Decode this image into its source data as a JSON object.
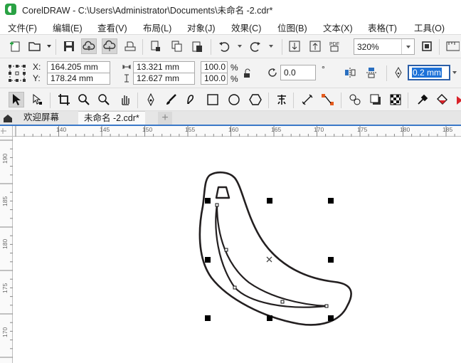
{
  "window": {
    "title": "CorelDRAW - C:\\Users\\Administrator\\Documents\\未命名 -2.cdr*"
  },
  "menu": {
    "items": [
      "文件(F)",
      "编辑(E)",
      "查看(V)",
      "布局(L)",
      "对象(J)",
      "效果(C)",
      "位图(B)",
      "文本(X)",
      "表格(T)",
      "工具(O)"
    ]
  },
  "toolbar": {
    "zoom_value": "320%"
  },
  "properties": {
    "x_label": "X:",
    "y_label": "Y:",
    "x_value": "164.205 mm",
    "y_value": "178.24 mm",
    "width_value": "13.321 mm",
    "height_value": "12.627 mm",
    "scale_w": "100.0",
    "scale_h": "100.0",
    "percent": "%",
    "rotation_value": "0.0",
    "rotation_unit": "°",
    "outline_width": "0.2 mm"
  },
  "tabs": {
    "welcome": "欢迎屏幕",
    "document": "未命名 -2.cdr*",
    "add": "+"
  },
  "rulers": {
    "horizontal_labels": [
      "140",
      "145",
      "150",
      "155",
      "160",
      "165",
      "170",
      "175",
      "180",
      "185"
    ],
    "vertical_labels": [
      "190",
      "185",
      "180",
      "175",
      "170"
    ]
  },
  "colors": {
    "accent": "#3a78c8",
    "logo": "#2aa244",
    "selection": "#1e72d8"
  }
}
